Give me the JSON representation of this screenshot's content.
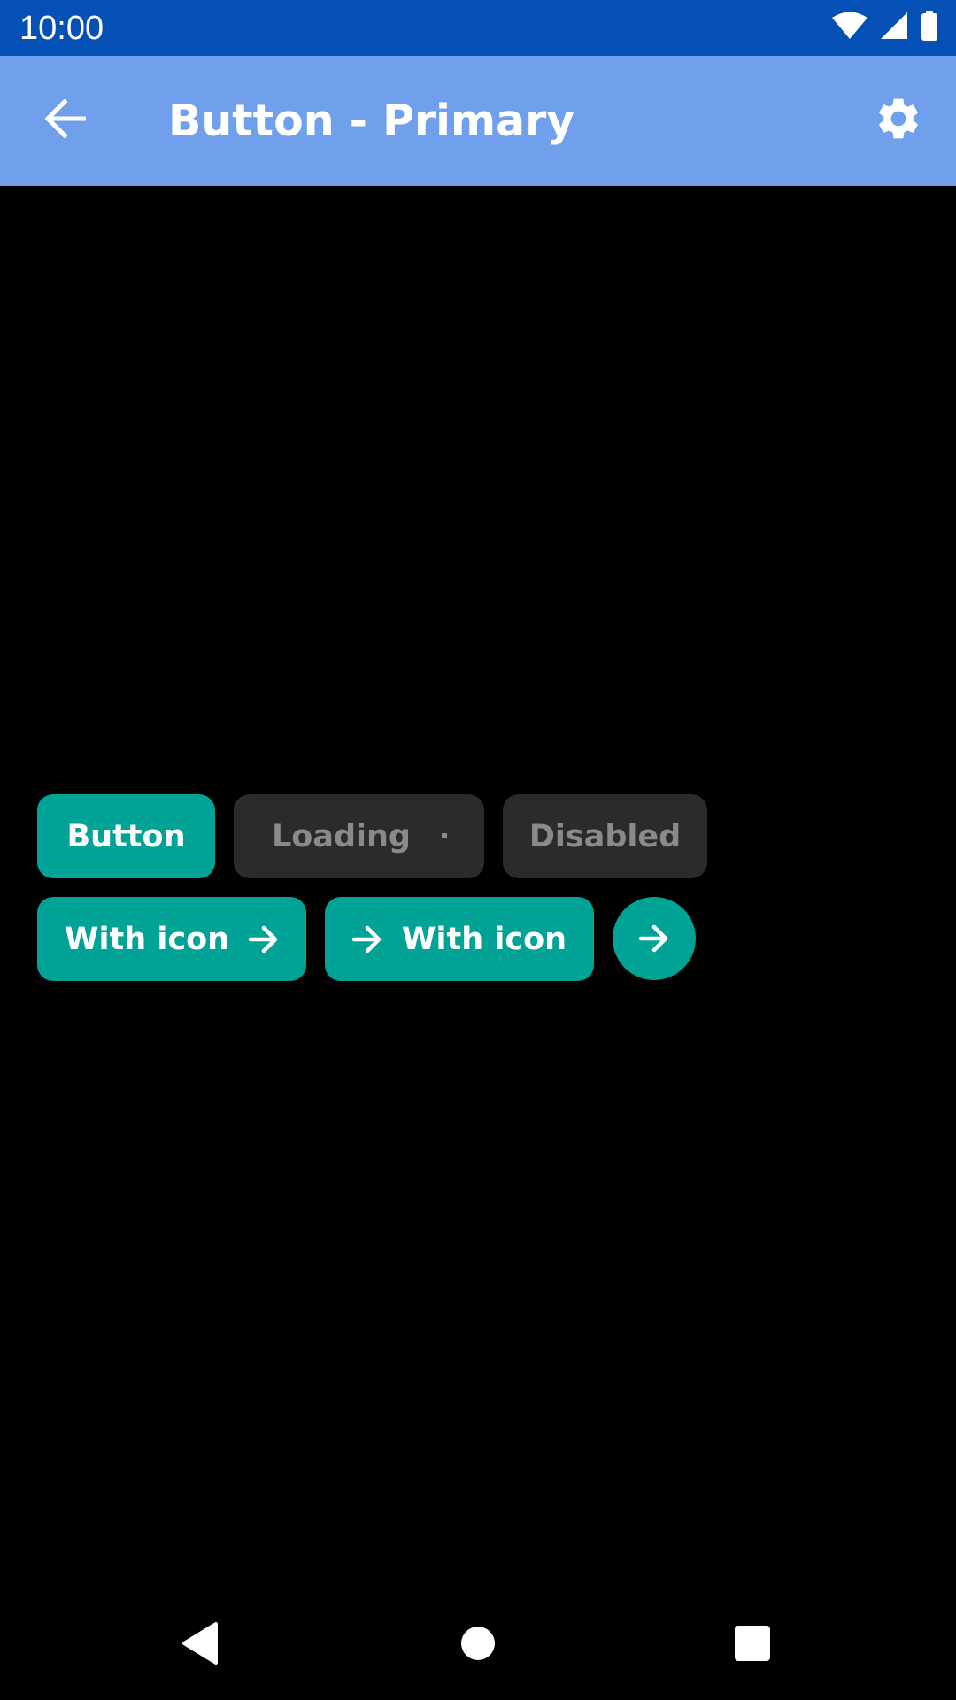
{
  "status_bar": {
    "time": "10:00",
    "icons": [
      "wifi-icon",
      "signal-icon",
      "battery-icon"
    ]
  },
  "app_bar": {
    "title": "Button - Primary",
    "back_icon": "back-arrow-icon",
    "settings_icon": "gear-icon"
  },
  "buttons": {
    "button_label": "Button",
    "loading_label": "Loading",
    "disabled_label": "Disabled",
    "with_icon_trailing_label": "With icon",
    "with_icon_leading_label": "With icon",
    "icon_only": "arrow-right-icon"
  },
  "nav_bar": {
    "back": "nav-back-icon",
    "home": "nav-home-icon",
    "recents": "nav-recents-icon"
  },
  "colors": {
    "status_bar": "#0550b5",
    "app_bar": "#70a0eb",
    "primary": "#00a396",
    "muted_bg": "#2b2b2d",
    "muted_text": "#8a8a8d",
    "background": "#000000"
  }
}
